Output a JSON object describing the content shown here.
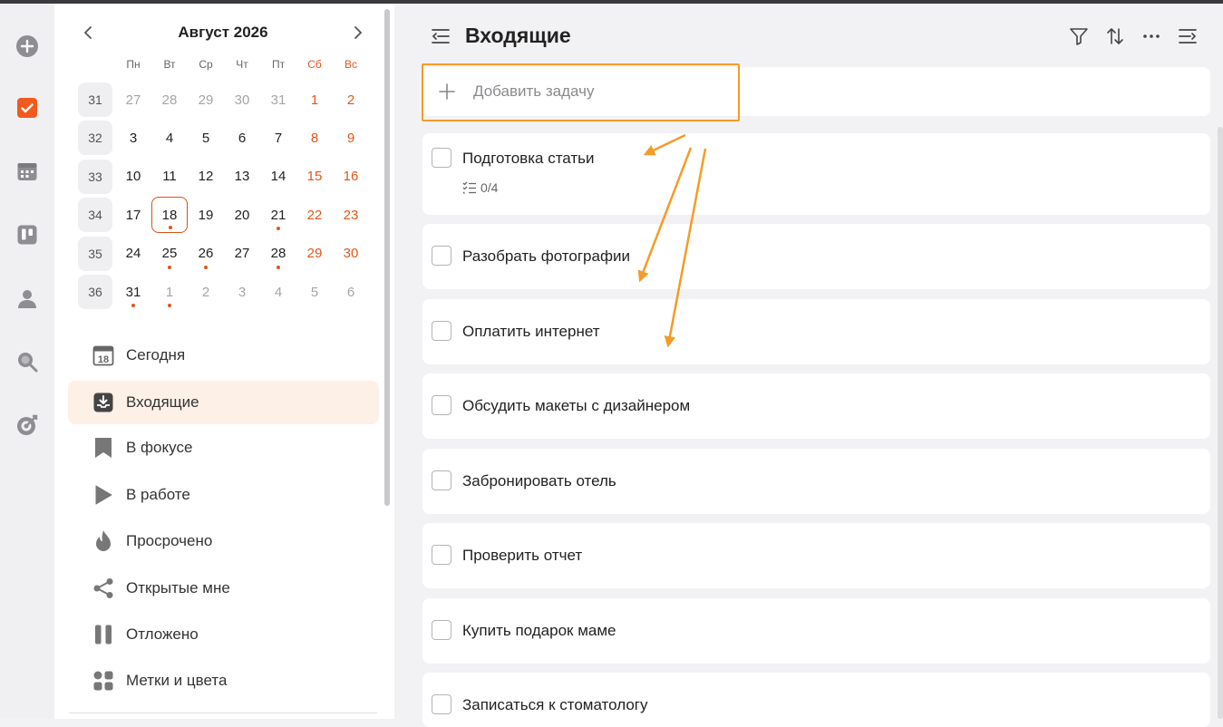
{
  "calendar": {
    "month_label": "Август 2026",
    "weekdays": [
      "Пн",
      "Вт",
      "Ср",
      "Чт",
      "Пт",
      "Сб",
      "Вс"
    ],
    "weeks": [
      {
        "num": "31",
        "days": [
          {
            "d": "27",
            "muted": true
          },
          {
            "d": "28",
            "muted": true
          },
          {
            "d": "29",
            "muted": true
          },
          {
            "d": "30",
            "muted": true
          },
          {
            "d": "31",
            "muted": true
          },
          {
            "d": "1",
            "we": true
          },
          {
            "d": "2",
            "we": true
          }
        ]
      },
      {
        "num": "32",
        "days": [
          {
            "d": "3"
          },
          {
            "d": "4"
          },
          {
            "d": "5"
          },
          {
            "d": "6"
          },
          {
            "d": "7"
          },
          {
            "d": "8",
            "we": true
          },
          {
            "d": "9",
            "we": true
          }
        ]
      },
      {
        "num": "33",
        "days": [
          {
            "d": "10"
          },
          {
            "d": "11"
          },
          {
            "d": "12"
          },
          {
            "d": "13"
          },
          {
            "d": "14"
          },
          {
            "d": "15",
            "we": true
          },
          {
            "d": "16",
            "we": true
          }
        ]
      },
      {
        "num": "34",
        "days": [
          {
            "d": "17"
          },
          {
            "d": "18",
            "today": true,
            "dot": true
          },
          {
            "d": "19"
          },
          {
            "d": "20"
          },
          {
            "d": "21",
            "dot": true
          },
          {
            "d": "22",
            "we": true
          },
          {
            "d": "23",
            "we": true
          }
        ]
      },
      {
        "num": "35",
        "days": [
          {
            "d": "24"
          },
          {
            "d": "25",
            "dot": true
          },
          {
            "d": "26",
            "dot": true
          },
          {
            "d": "27"
          },
          {
            "d": "28",
            "dot": true
          },
          {
            "d": "29",
            "we": true
          },
          {
            "d": "30",
            "we": true
          }
        ]
      },
      {
        "num": "36",
        "days": [
          {
            "d": "31",
            "dot": true
          },
          {
            "d": "1",
            "muted": true,
            "dot": true
          },
          {
            "d": "2",
            "muted": true
          },
          {
            "d": "3",
            "muted": true
          },
          {
            "d": "4",
            "muted": true
          },
          {
            "d": "5",
            "muted": true
          },
          {
            "d": "6",
            "muted": true
          }
        ]
      }
    ]
  },
  "nav": [
    {
      "label": "Сегодня",
      "icon": "calendar-18-icon",
      "day": "18"
    },
    {
      "label": "Входящие",
      "icon": "inbox-icon",
      "active": true
    },
    {
      "label": "В фокусе",
      "icon": "bookmark-icon"
    },
    {
      "label": "В работе",
      "icon": "play-icon"
    },
    {
      "label": "Просрочено",
      "icon": "flame-icon"
    },
    {
      "label": "Открытые мне",
      "icon": "share-icon"
    },
    {
      "label": "Отложено",
      "icon": "pause-icon"
    },
    {
      "label": "Метки и цвета",
      "icon": "tags-grid-icon"
    }
  ],
  "header": {
    "title": "Входящие"
  },
  "add_task": {
    "placeholder": "Добавить задачу"
  },
  "tasks": [
    {
      "title": "Подготовка статьи",
      "subtasks": "0/4"
    },
    {
      "title": "Разобрать фотографии"
    },
    {
      "title": "Оплатить интернет"
    },
    {
      "title": "Обсудить макеты с дизайнером"
    },
    {
      "title": "Забронировать отель"
    },
    {
      "title": "Проверить отчет"
    },
    {
      "title": "Купить подарок маме"
    },
    {
      "title": "Записаться к стоматологу"
    }
  ],
  "colors": {
    "accent": "#e2561b",
    "annotation": "#f59b27",
    "active_bg": "#fdf0e6"
  }
}
